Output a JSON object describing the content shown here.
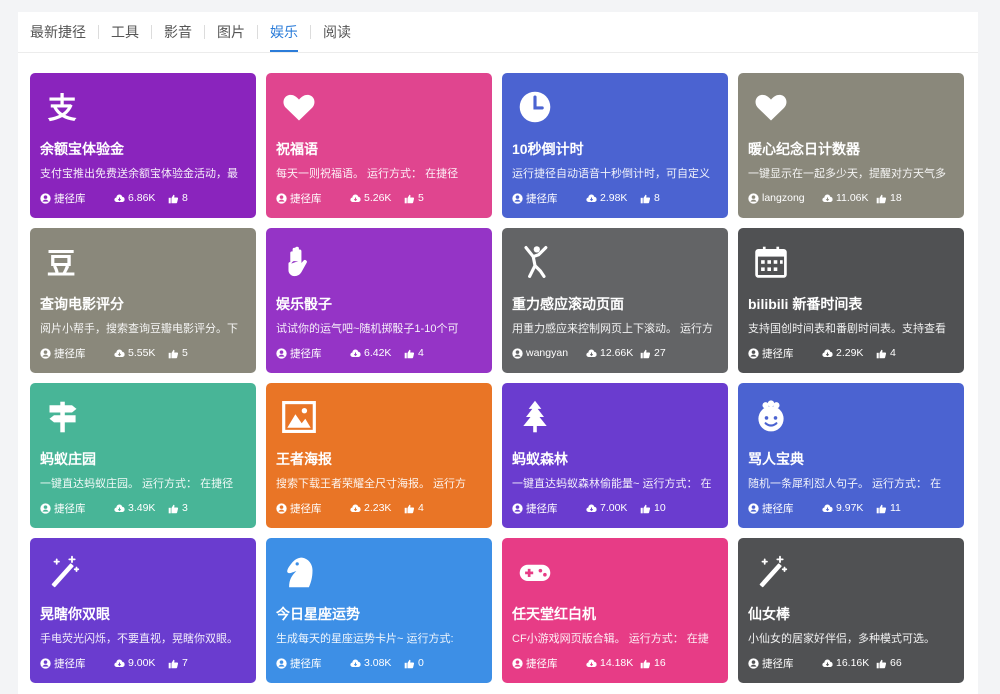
{
  "tabs": [
    {
      "label": "最新捷径",
      "active": false
    },
    {
      "label": "工具",
      "active": false
    },
    {
      "label": "影音",
      "active": false
    },
    {
      "label": "图片",
      "active": false
    },
    {
      "label": "娱乐",
      "active": true
    },
    {
      "label": "阅读",
      "active": false
    }
  ],
  "cards": [
    {
      "title": "余额宝体验金",
      "desc": "支付宝推出免费送余额宝体验金活动，最",
      "author": "捷径库",
      "downloads": "6.86K",
      "likes": "8",
      "color": "#8a24bd",
      "icon": "yuebao-logo-icon"
    },
    {
      "title": "祝福语",
      "desc": "每天一则祝福语。 运行方式： 在捷径",
      "author": "捷径库",
      "downloads": "5.26K",
      "likes": "5",
      "color": "#e0458f",
      "icon": "heart-icon"
    },
    {
      "title": "10秒倒计时",
      "desc": "运行捷径自动语音十秒倒计时，可自定义",
      "author": "捷径库",
      "downloads": "2.98K",
      "likes": "8",
      "color": "#4b63d1",
      "icon": "clock-icon"
    },
    {
      "title": "暖心纪念日计数器",
      "desc": "一键显示在一起多少天，提醒对方天气多",
      "author": "langzong",
      "downloads": "11.06K",
      "likes": "18",
      "color": "#8a887b",
      "icon": "heart-icon"
    },
    {
      "title": "查询电影评分",
      "desc": "阅片小帮手，搜索查询豆瓣电影评分。下",
      "author": "捷径库",
      "downloads": "5.55K",
      "likes": "5",
      "color": "#8a887b",
      "icon": "douban-icon"
    },
    {
      "title": "娱乐骰子",
      "desc": "试试你的运气吧~随机掷骰子1-10个可",
      "author": "捷径库",
      "downloads": "6.42K",
      "likes": "4",
      "color": "#9534c6",
      "icon": "hand-icon"
    },
    {
      "title": "重力感应滚动页面",
      "desc": "用重力感应来控制网页上下滚动。 运行方",
      "author": "wangyan",
      "downloads": "12.66K",
      "likes": "27",
      "color": "#636466",
      "icon": "dancer-icon"
    },
    {
      "title": "bilibili 新番时间表",
      "desc": "支持国创时间表和番剧时间表。支持查看",
      "author": "捷径库",
      "downloads": "2.29K",
      "likes": "4",
      "color": "#505153",
      "icon": "calendar-icon"
    },
    {
      "title": "蚂蚁庄园",
      "desc": "一键直达蚂蚁庄园。 运行方式： 在捷径",
      "author": "捷径库",
      "downloads": "3.49K",
      "likes": "3",
      "color": "#48b597",
      "icon": "signpost-icon"
    },
    {
      "title": "王者海报",
      "desc": "搜索下载王者荣耀全尺寸海报。 运行方",
      "author": "捷径库",
      "downloads": "2.23K",
      "likes": "4",
      "color": "#e97526",
      "icon": "image-icon"
    },
    {
      "title": "蚂蚁森林",
      "desc": "一键直达蚂蚁森林偷能量~ 运行方式： 在",
      "author": "捷径库",
      "downloads": "7.00K",
      "likes": "10",
      "color": "#6a3ccf",
      "icon": "tree-icon"
    },
    {
      "title": "骂人宝典",
      "desc": "随机一条犀利怼人句子。 运行方式： 在",
      "author": "捷径库",
      "downloads": "9.97K",
      "likes": "11",
      "color": "#4b63d1",
      "icon": "baby-face-icon"
    },
    {
      "title": "晃瞎你双眼",
      "desc": "手电荧光闪烁，不要直视，晃瞎你双眼。",
      "author": "捷径库",
      "downloads": "9.00K",
      "likes": "7",
      "color": "#6a3ccf",
      "icon": "magic-wand-icon"
    },
    {
      "title": "今日星座运势",
      "desc": "生成每天的星座运势卡片~ 运行方式:",
      "author": "捷径库",
      "downloads": "3.08K",
      "likes": "0",
      "color": "#3d8fe6",
      "icon": "chess-knight-icon"
    },
    {
      "title": "任天堂红白机",
      "desc": "CF小游戏网页版合辑。 运行方式： 在捷",
      "author": "捷径库",
      "downloads": "14.18K",
      "likes": "16",
      "color": "#e73c86",
      "icon": "gamepad-icon"
    },
    {
      "title": "仙女棒",
      "desc": "小仙女的居家好伴侣，多种模式可选。",
      "author": "捷径库",
      "downloads": "16.16K",
      "likes": "66",
      "color": "#505153",
      "icon": "magic-wand-icon"
    }
  ]
}
